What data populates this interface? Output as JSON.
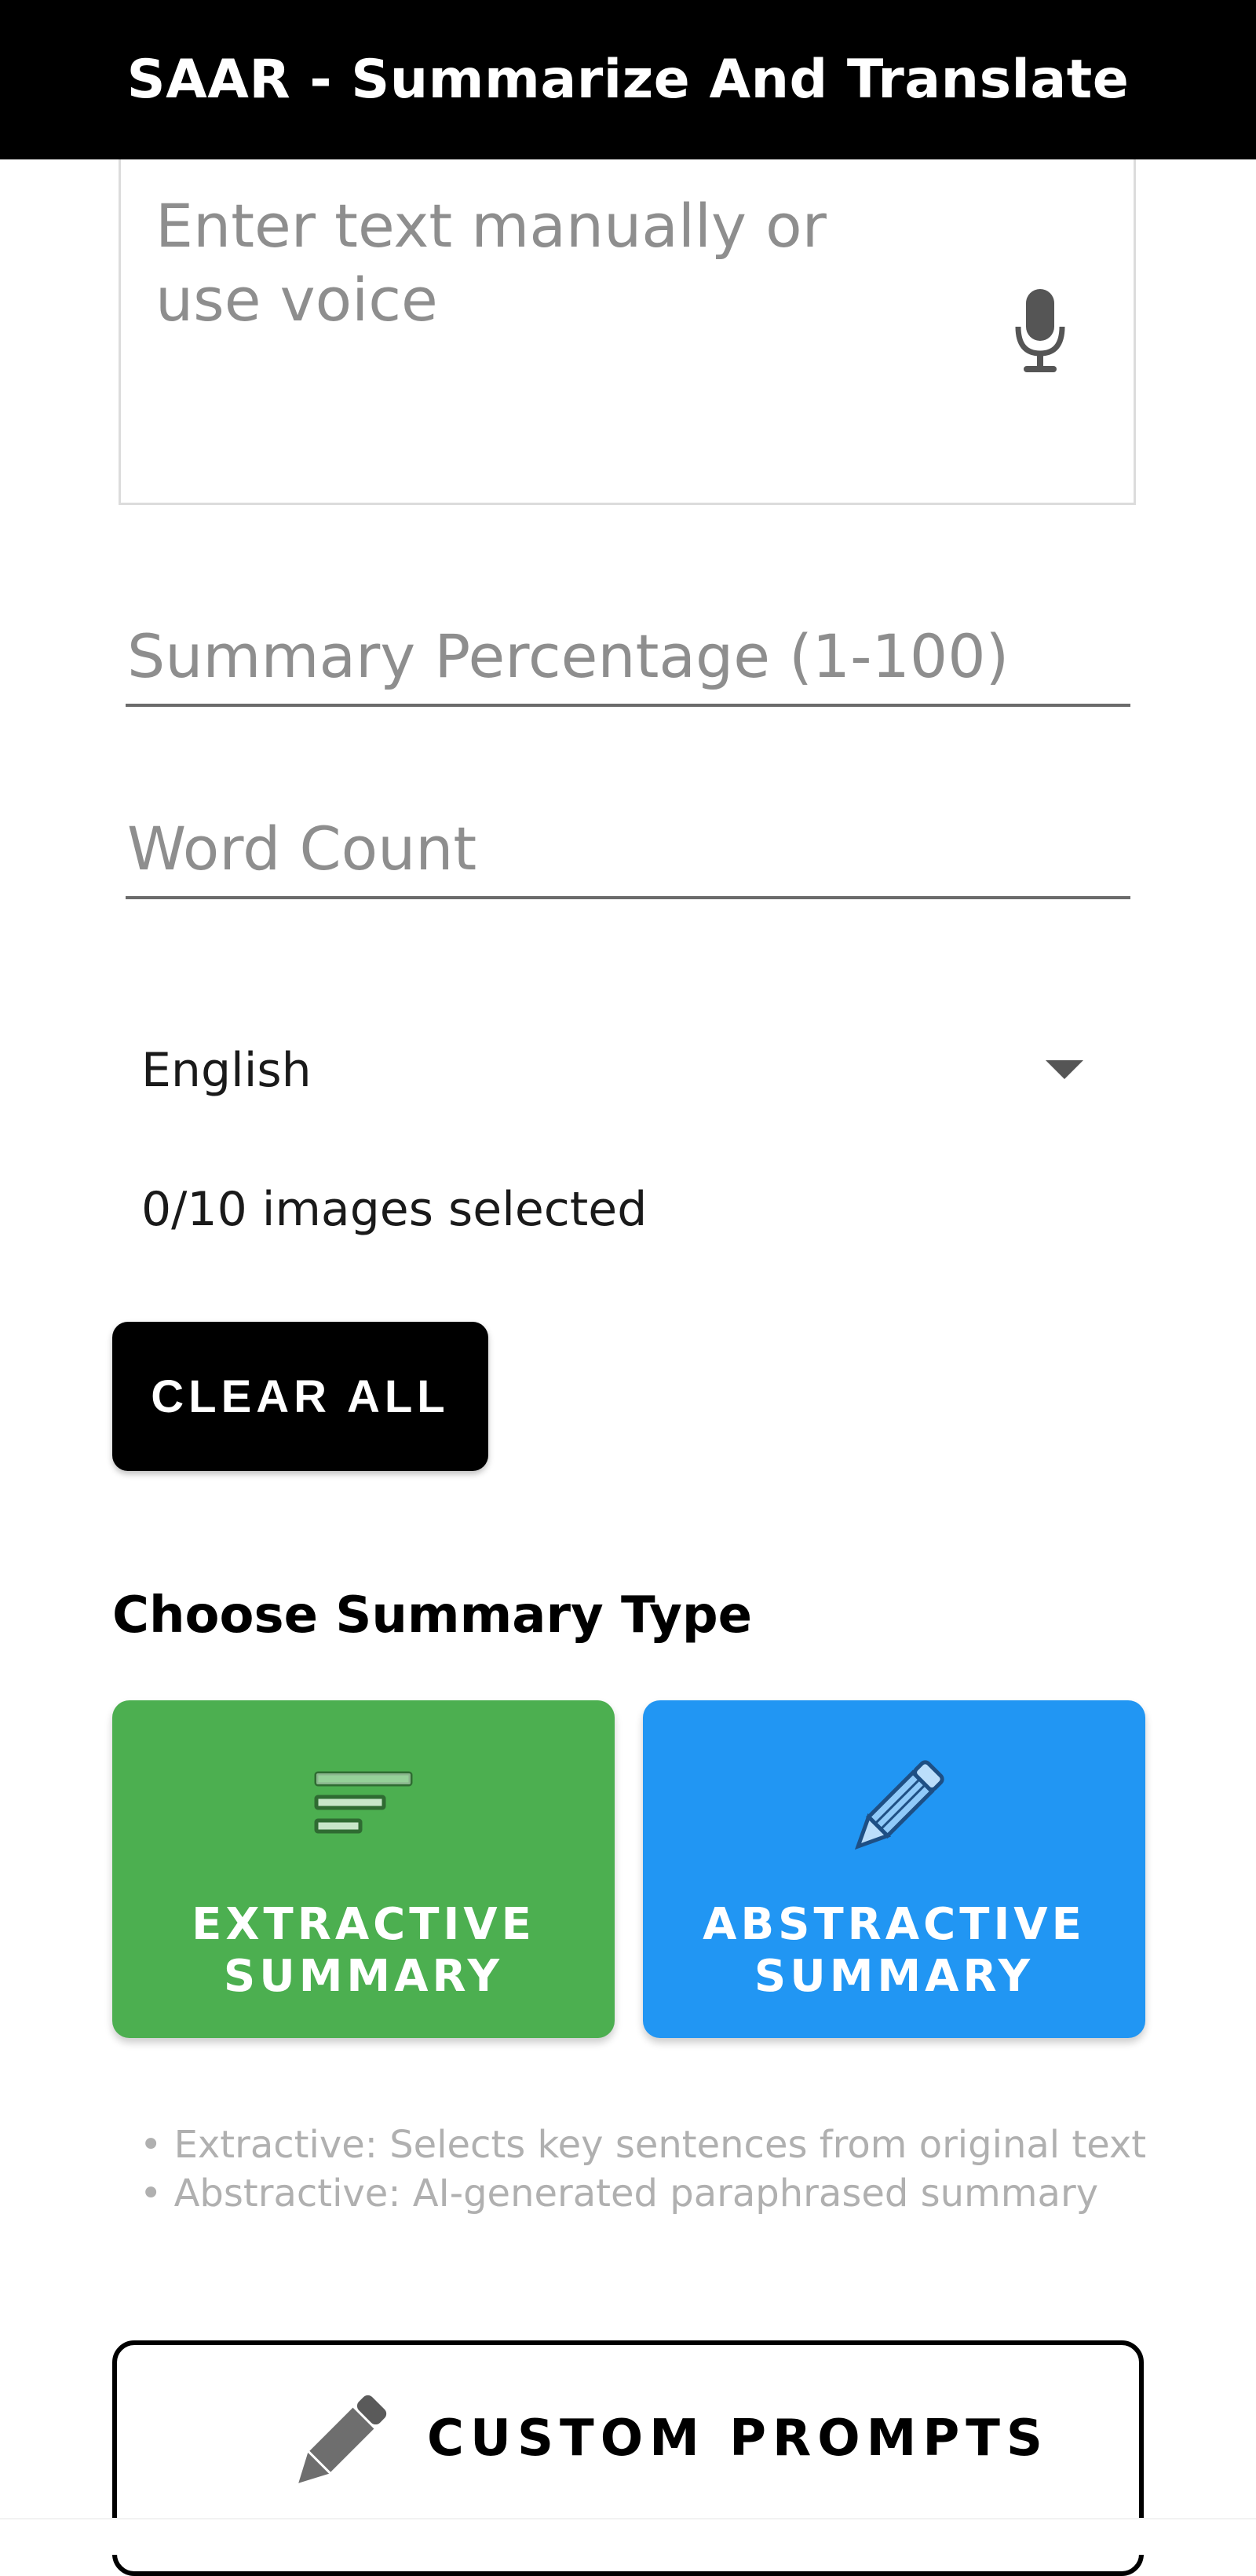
{
  "app_bar": {
    "title": "SAAR - Summarize And Translate"
  },
  "input": {
    "text_placeholder": "Enter text manually or use voice",
    "mic_icon": "microphone-icon"
  },
  "fields": {
    "summary_percentage_placeholder": "Summary Percentage (1-100)",
    "word_count_placeholder": "Word Count"
  },
  "language": {
    "selected": "English",
    "arrow_icon": "dropdown-arrow-icon"
  },
  "images": {
    "status": "0/10 images selected"
  },
  "buttons": {
    "clear_all": "CLEAR ALL"
  },
  "summary_type": {
    "title": "Choose Summary Type",
    "options": [
      {
        "label": "EXTRACTIVE SUMMARY",
        "icon": "text-lines-icon",
        "color": "#4caf50"
      },
      {
        "label": "ABSTRACTIVE SUMMARY",
        "icon": "pencil-icon",
        "color": "#2196f3"
      }
    ],
    "hints": [
      "• Extractive: Selects key sentences from original text",
      "• Abstractive: AI-generated paraphrased summary"
    ]
  },
  "custom_prompts": {
    "label": "CUSTOM PROMPTS",
    "icon": "pencil-icon"
  }
}
